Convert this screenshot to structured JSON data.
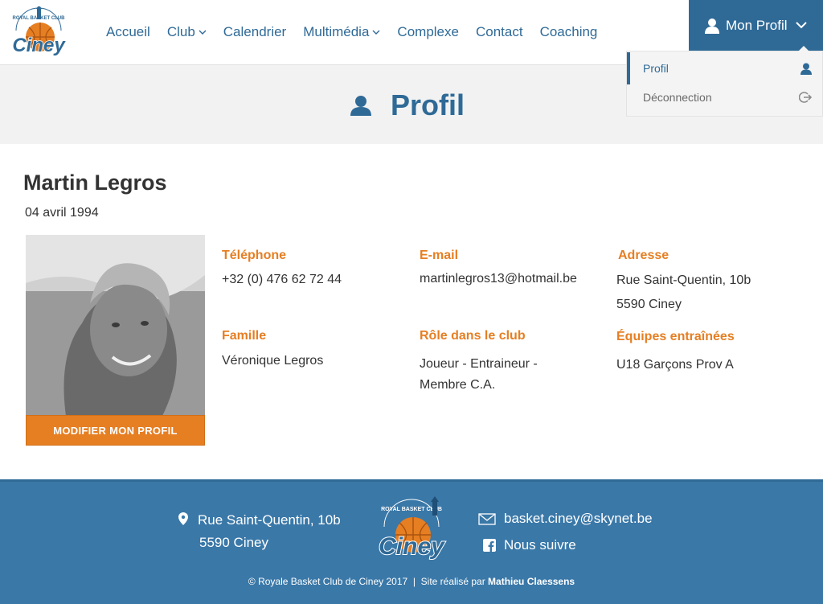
{
  "brand": {
    "logo_top": "ROYAL BASKET CLUB",
    "logo_name": "Ciney",
    "primary": "#2f6a97",
    "accent": "#e67e22"
  },
  "nav": {
    "items": [
      {
        "label": "Accueil",
        "has_menu": false
      },
      {
        "label": "Club",
        "has_menu": true
      },
      {
        "label": "Calendrier",
        "has_menu": false
      },
      {
        "label": "Multimédia",
        "has_menu": true
      },
      {
        "label": "Complexe",
        "has_menu": false
      },
      {
        "label": "Contact",
        "has_menu": false
      },
      {
        "label": "Coaching",
        "has_menu": false
      }
    ],
    "profile_label": "Mon Profil"
  },
  "dropdown": {
    "items": [
      {
        "label": "Profil",
        "icon": "user-icon"
      },
      {
        "label": "Déconnection",
        "icon": "logout-icon"
      }
    ]
  },
  "page": {
    "title": "Profil"
  },
  "profile": {
    "name": "Martin Legros",
    "birthdate": "04 avril 1994",
    "edit_button": "MODIFIER MON PROFIL",
    "fields": {
      "phone_label": "Téléphone",
      "phone": "+32 (0) 476 62 72 44",
      "email_label": "E-mail",
      "email": "martinlegros13@hotmail.be",
      "address_label": "Adresse",
      "address_line1": "Rue Saint-Quentin, 10b",
      "address_line2": "5590 Ciney",
      "family_label": "Famille",
      "family": "Véronique Legros",
      "role_label": "Rôle dans le club",
      "role_line1": "Joueur - Entraineur -",
      "role_line2": "Membre C.A.",
      "teams_label": "Équipes entraînées",
      "teams": "U18 Garçons Prov A"
    }
  },
  "footer": {
    "address_line1": "Rue Saint-Quentin, 10b",
    "address_line2": "5590 Ciney",
    "email": "basket.ciney@skynet.be",
    "social": "Nous suivre",
    "copyright": "© Royale Basket Club de Ciney 2017",
    "separator": "|",
    "credit_prefix": "Site réalisé par",
    "credit_name": "Mathieu Claessens"
  }
}
